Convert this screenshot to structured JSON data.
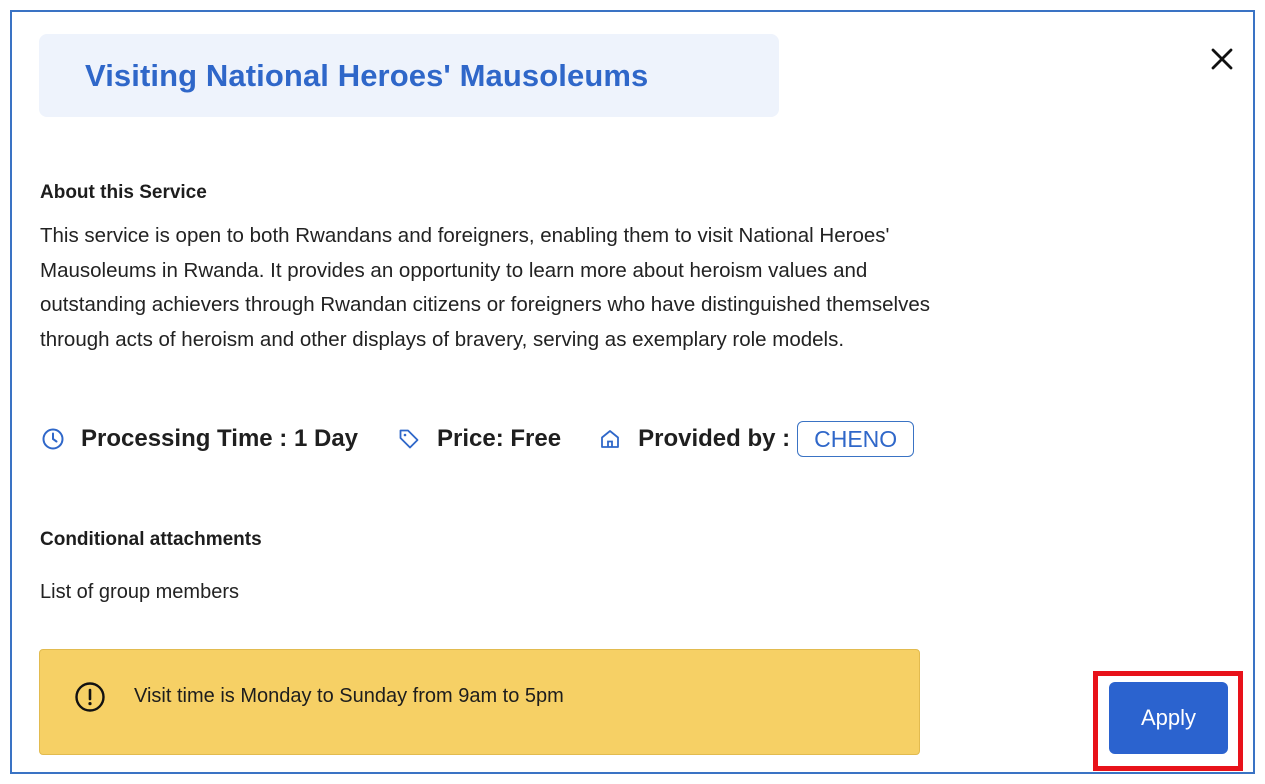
{
  "modal": {
    "title": "Visiting National Heroes' Mausoleums",
    "close_icon": "close-icon"
  },
  "about": {
    "heading": "About this Service",
    "lines": [
      "This service is open to both Rwandans and foreigners, enabling them to visit National Heroes'",
      "Mausoleums in Rwanda. It provides an opportunity to learn more about heroism values and",
      "outstanding achievers through Rwandan citizens or foreigners who have distinguished themselves",
      "through acts of heroism and other displays of bravery, serving as exemplary role models."
    ]
  },
  "meta": {
    "processing_time": "Processing Time : 1 Day",
    "price": "Price: Free",
    "provided_by_label": "Provided by :",
    "provider": "CHENO",
    "icons": [
      "clock-icon",
      "tag-icon",
      "home-icon"
    ]
  },
  "attachments": {
    "heading": "Conditional attachments",
    "items": [
      "List of group members"
    ]
  },
  "notice": {
    "text": "Visit time is Monday to Sunday from 9am to 5pm",
    "icon": "alert-circle-icon"
  },
  "actions": {
    "apply_label": "Apply"
  },
  "colors": {
    "accent": "#2f67c9",
    "apply_button": "#2b63cf",
    "notice_bg": "#f6d065",
    "title_bg": "#eef3fc",
    "highlight_outline": "#e8121a"
  }
}
